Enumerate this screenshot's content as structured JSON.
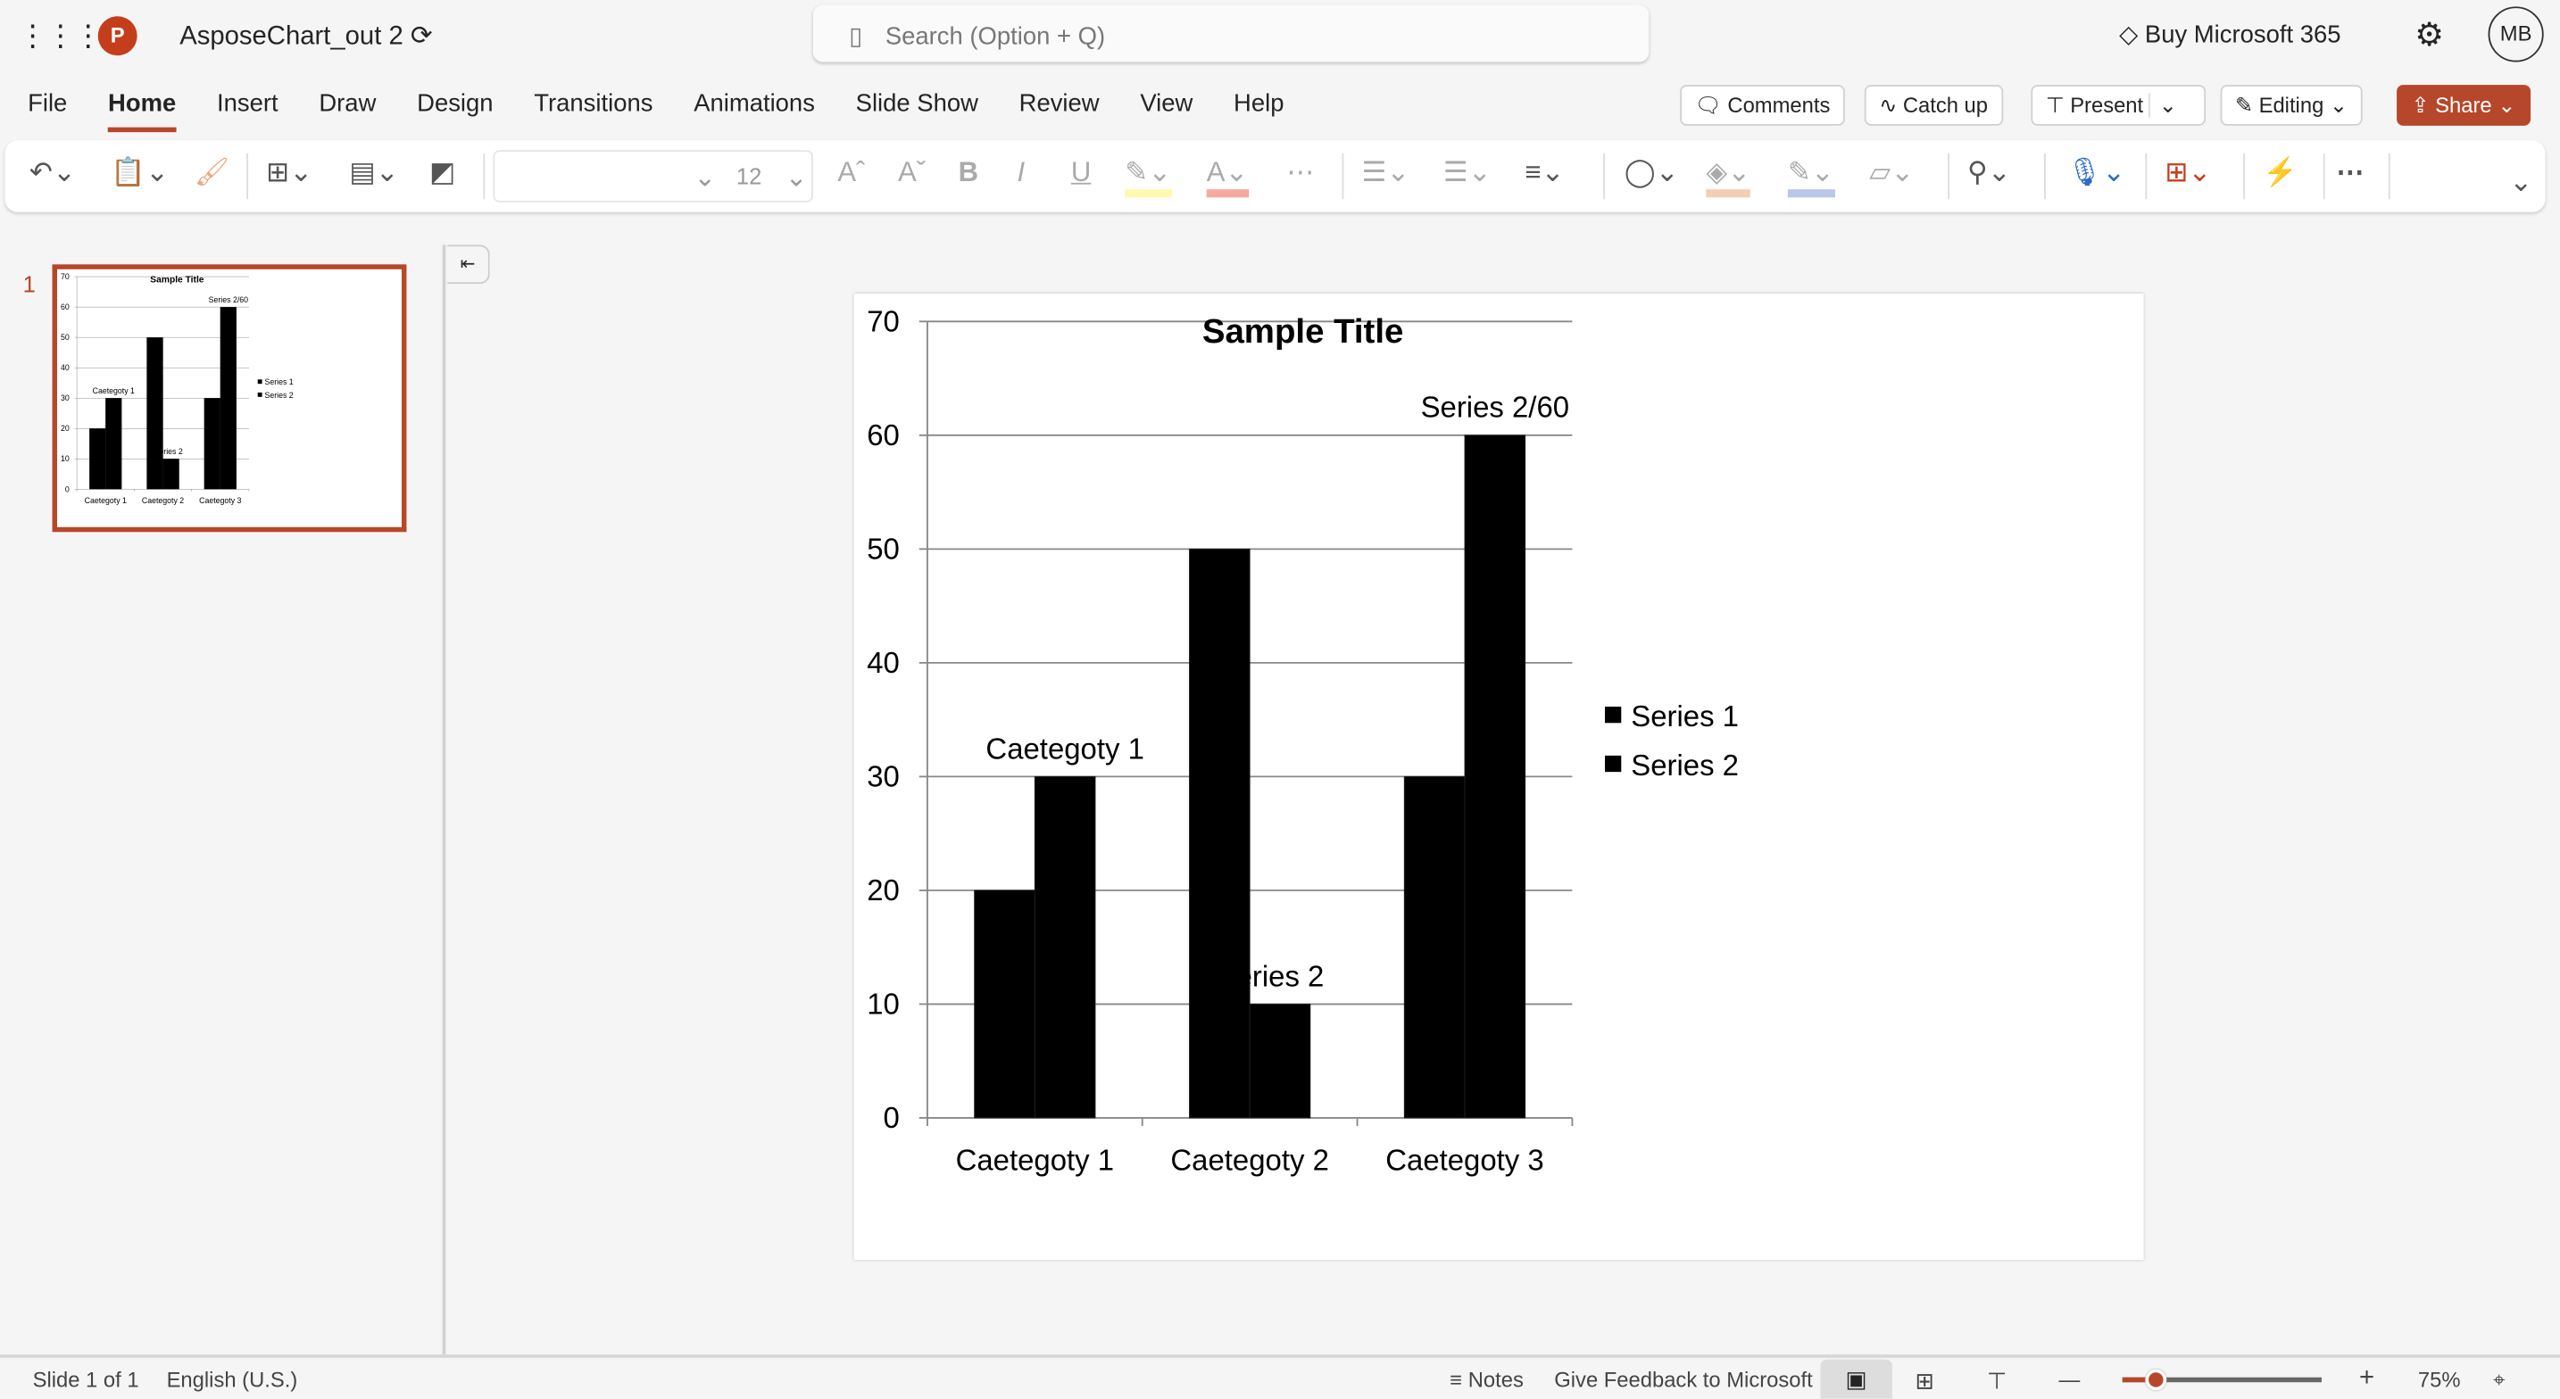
{
  "app": {
    "title": "AsposeChart_out 2",
    "logo_letter": "P",
    "search_placeholder": "Search (Option + Q)",
    "buy": "Buy Microsoft 365",
    "avatar": "MB"
  },
  "menu_tabs": [
    "File",
    "Home",
    "Insert",
    "Draw",
    "Design",
    "Transitions",
    "Animations",
    "Slide Show",
    "Review",
    "View",
    "Help"
  ],
  "active_tab": "Home",
  "actions": {
    "comments": "Comments",
    "catchup": "Catch up",
    "present": "Present",
    "editing": "Editing",
    "share": "Share"
  },
  "ribbon": {
    "font_size": "12"
  },
  "colors": {
    "accent": "#b7472a",
    "bar": "#000000"
  },
  "slides_panel": {
    "number": "1"
  },
  "status": {
    "slide": "Slide 1 of 1",
    "language": "English (U.S.)",
    "notes": "Notes",
    "feedback": "Give Feedback to Microsoft",
    "zoom": "75%",
    "zoom_percent": 75
  },
  "chart_data": {
    "type": "bar",
    "title": "Sample Title",
    "categories": [
      "Caetegoty 1",
      "Caetegoty 2",
      "Caetegoty 3"
    ],
    "series": [
      {
        "name": "Series 1",
        "values": [
          20,
          50,
          30
        ]
      },
      {
        "name": "Series 2",
        "values": [
          30,
          10,
          60
        ]
      }
    ],
    "ylim": [
      0,
      70
    ],
    "yticks": [
      0,
      10,
      20,
      30,
      40,
      50,
      60,
      70
    ],
    "grid": true,
    "legend": "right",
    "data_labels": [
      {
        "series": 1,
        "category": 0,
        "text": "Caetegoty 1"
      },
      {
        "series": 1,
        "category": 1,
        "text": "eries 2"
      },
      {
        "series": 1,
        "category": 2,
        "text": "Series 2/60"
      }
    ]
  }
}
